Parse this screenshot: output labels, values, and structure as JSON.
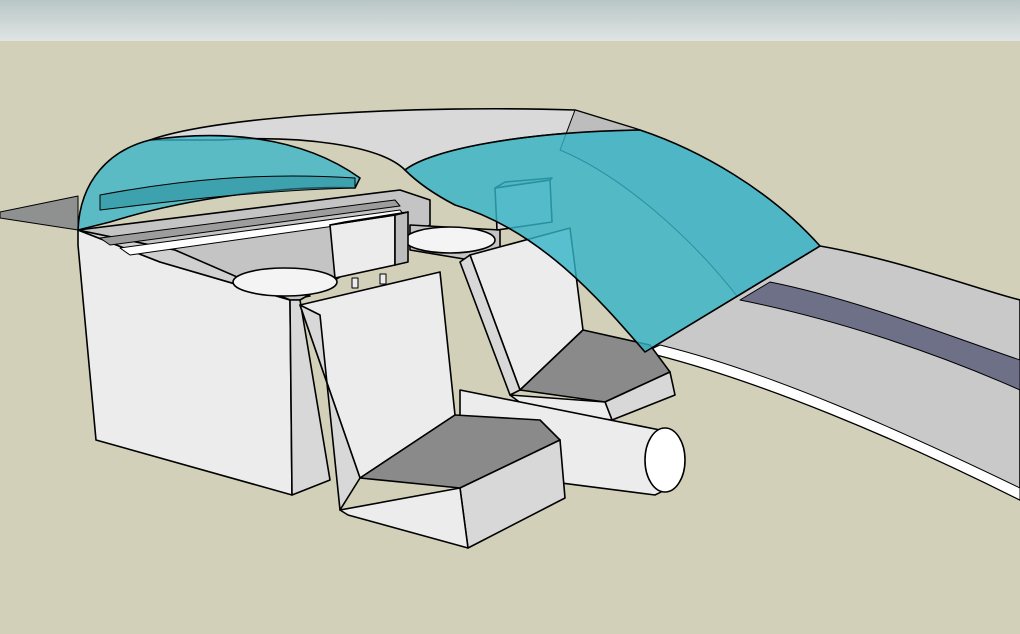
{
  "viewport": {
    "sky_color": "#dfe5e4",
    "ground_color": "#d3d0b9",
    "glass_color": "#33b4c8",
    "face_light": "#ececec",
    "face_mid": "#c8c8c8",
    "face_dark": "#8a8a8a",
    "strip_color": "#6e7088"
  }
}
